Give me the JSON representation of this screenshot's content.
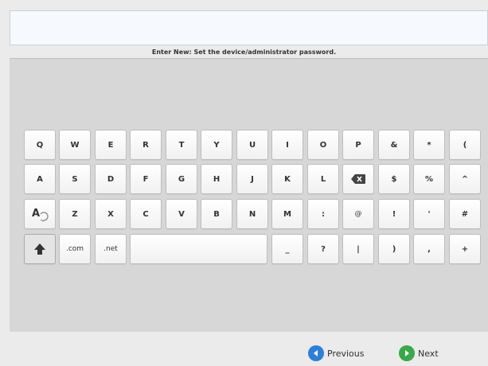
{
  "prompt": "Enter New: Set the device/administrator password.",
  "keyboard": {
    "row1": [
      "Q",
      "W",
      "E",
      "R",
      "T",
      "Y",
      "U",
      "I",
      "O",
      "P",
      "&",
      "*",
      "("
    ],
    "row2": [
      "A",
      "S",
      "D",
      "F",
      "G",
      "H",
      "J",
      "K",
      "L",
      "$",
      "%",
      "^"
    ],
    "row3": [
      "Z",
      "X",
      "C",
      "V",
      "B",
      "N",
      "M",
      ":",
      "@",
      "!",
      "'",
      "#"
    ],
    "row4": [
      ".com",
      ".net",
      "_",
      "?",
      "|",
      ")",
      ",",
      "+"
    ]
  },
  "icons": {
    "shift": "shift-up-arrow-icon",
    "backspace": "backspace-icon",
    "alt_chars": "alternate-characters-icon",
    "previous": "previous-arrow-icon",
    "next": "next-arrow-icon"
  },
  "nav": {
    "previous_label": "Previous",
    "next_label": "Next"
  },
  "colors": {
    "panel": "#d7d7d7",
    "key_face": "#f5f5f5",
    "previous_icon": "#2f7fd6",
    "next_icon": "#3aa84a"
  }
}
